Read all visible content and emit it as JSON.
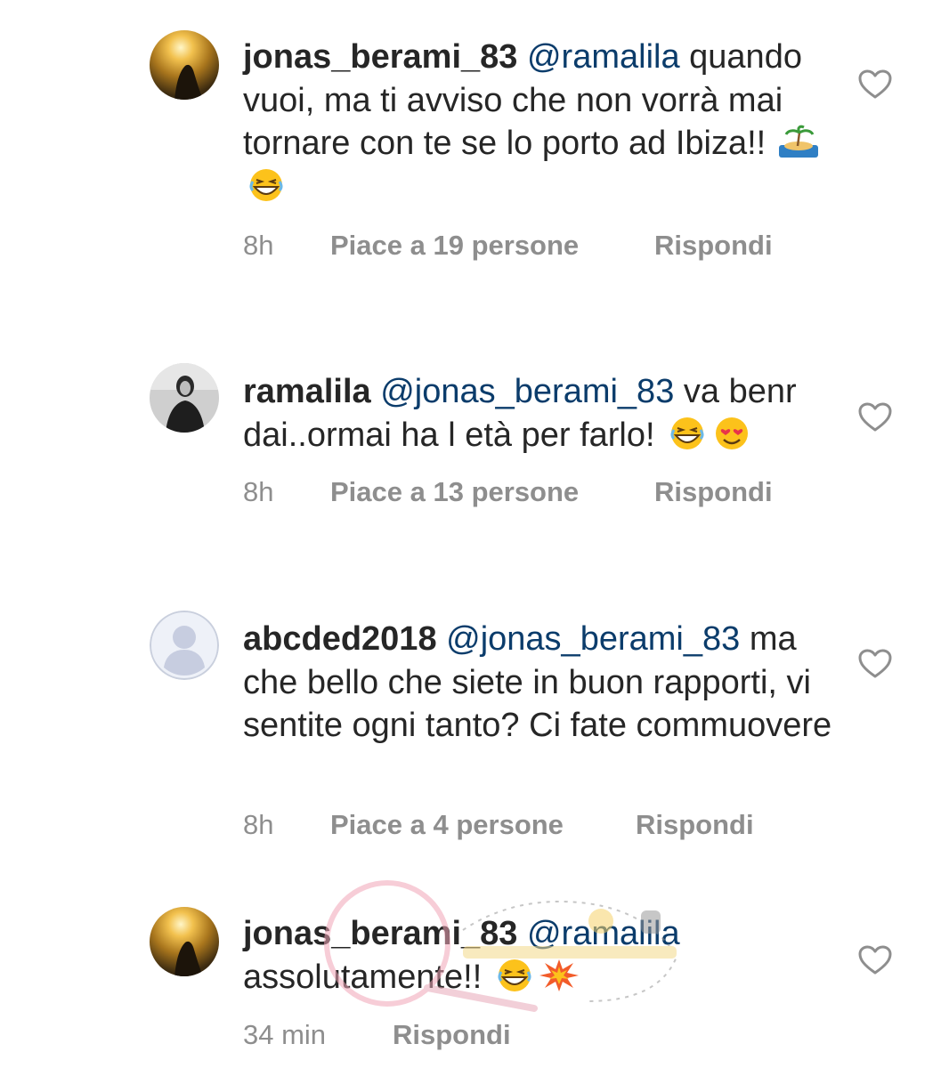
{
  "comments": [
    {
      "username": "jonas_berami_83",
      "mention": "@ramalila",
      "text": "quando vuoi, ma ti avviso che non vorrà mai tornare con te se lo porto ad Ibiza!!",
      "emojis": [
        "beach-island-emoji",
        "grinning-squint-emoji"
      ],
      "time": "8h",
      "likes": "Piace a 19 persone",
      "reply": "Rispondi",
      "avatar": "sunset-silhouette-avatar"
    },
    {
      "username": "ramalila",
      "mention": "@jonas_berami_83",
      "text": "va benr dai..ormai ha l età per farlo!",
      "emojis": [
        "grinning-squint-emoji",
        "heart-eyes-emoji"
      ],
      "time": "8h",
      "likes": "Piace a 13 persone",
      "reply": "Rispondi",
      "avatar": "bw-portrait-avatar"
    },
    {
      "username": "abcded2018",
      "mention": "@jonas_berami_83",
      "text": "ma che bello che siete in buon rapporti, vi sentite ogni tanto? Ci fate commuovere",
      "emojis": [],
      "time": "8h",
      "likes": "Piace a 4 persone",
      "reply": "Rispondi",
      "avatar": "default-user-avatar"
    },
    {
      "username": "jonas_berami_83",
      "mention": "@ramalila",
      "text": "assolutamente!!",
      "emojis": [
        "grinning-squint-emoji",
        "collision-emoji"
      ],
      "time": "34 min",
      "likes": "",
      "reply": "Rispondi",
      "avatar": "sunset-silhouette-avatar"
    }
  ],
  "colors": {
    "text": "#262626",
    "mention": "#0b3c6b",
    "meta": "#8e8e8e",
    "heart_outline": "#8e8e8e"
  }
}
